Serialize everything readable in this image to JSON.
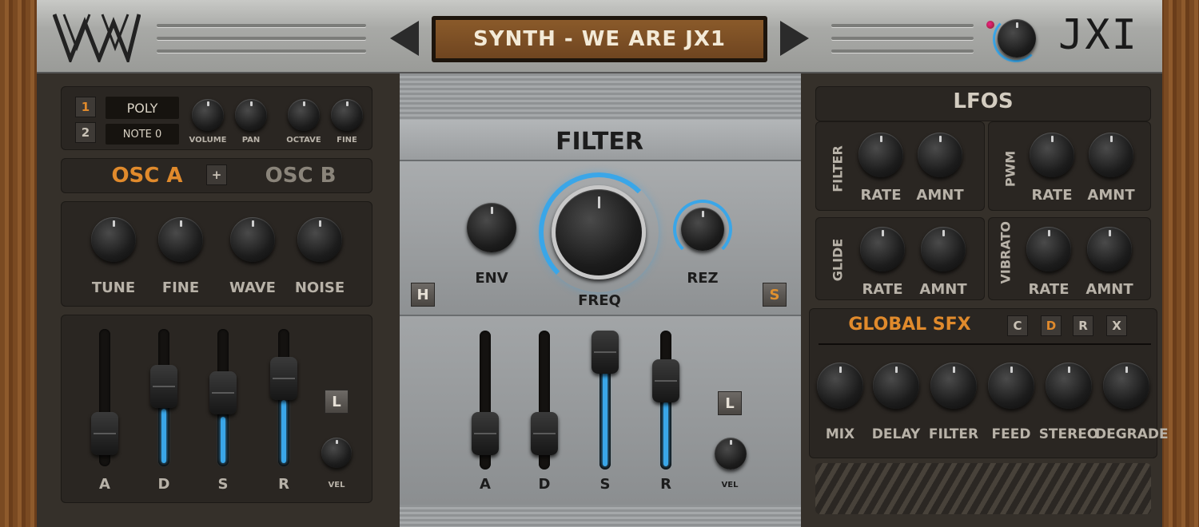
{
  "header": {
    "preset_name": "SYNTH - WE ARE JX1",
    "brand": "JXI"
  },
  "voice": {
    "osc1": "1",
    "osc2": "2",
    "mode": "POLY",
    "note": "NOTE 0",
    "knobs": [
      "VOLUME",
      "PAN",
      "OCTAVE",
      "FINE"
    ]
  },
  "osc": {
    "tab_a": "OSC A",
    "plus": "+",
    "tab_b": "OSC B",
    "knobs": [
      "TUNE",
      "FINE",
      "WAVE",
      "NOISE"
    ]
  },
  "amp_env": {
    "labels": [
      "A",
      "D",
      "S",
      "R"
    ],
    "values": [
      0.12,
      0.62,
      0.55,
      0.7
    ],
    "loop_btn": "L",
    "vel": "VEL"
  },
  "filter": {
    "title": "FILTER",
    "env": "ENV",
    "freq": "FREQ",
    "rez": "REZ",
    "h_btn": "H",
    "s_btn": "S",
    "adsr_labels": [
      "A",
      "D",
      "S",
      "R"
    ],
    "adsr_values": [
      0.15,
      0.15,
      1.0,
      0.7
    ],
    "loop_btn": "L",
    "vel": "VEL"
  },
  "lfos": {
    "title": "LFOS",
    "groups": [
      {
        "name": "FILTER",
        "rate": "RATE",
        "amnt": "AMNT"
      },
      {
        "name": "PWM",
        "rate": "RATE",
        "amnt": "AMNT"
      },
      {
        "name": "GLIDE",
        "rate": "RATE",
        "amnt": "AMNT"
      },
      {
        "name": "VIBRATO",
        "rate": "RATE",
        "amnt": "AMNT"
      }
    ]
  },
  "sfx": {
    "title": "GLOBAL SFX",
    "buttons": [
      "C",
      "D",
      "R",
      "X"
    ],
    "knobs": [
      "MIX",
      "DELAY",
      "FILTER",
      "FEED",
      "STEREO",
      "DEGRADE"
    ]
  },
  "colors": {
    "accent_orange": "#e08a2c",
    "accent_blue": "#3aa6e8"
  }
}
